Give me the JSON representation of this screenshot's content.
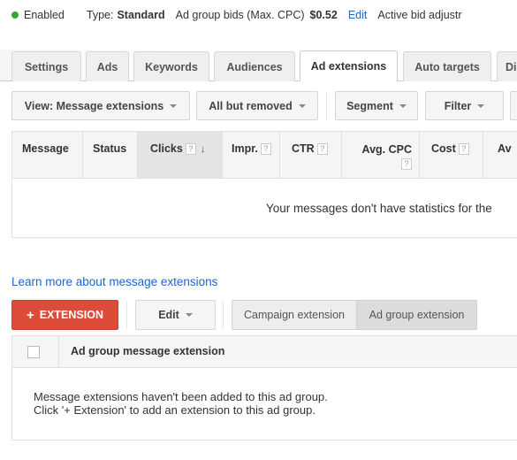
{
  "status_bar": {
    "status": "Enabled",
    "status_color": "#35a739",
    "type_label": "Type:",
    "type_value": "Standard",
    "bid_label": "Ad group bids (Max. CPC)",
    "bid_value": "$0.52",
    "edit_label": "Edit",
    "bid_adjust_label": "Active bid adjustr"
  },
  "tabs": [
    {
      "label": "Settings",
      "active": false
    },
    {
      "label": "Ads",
      "active": false
    },
    {
      "label": "Keywords",
      "active": false
    },
    {
      "label": "Audiences",
      "active": false
    },
    {
      "label": "Ad extensions",
      "active": true
    },
    {
      "label": "Auto targets",
      "active": false
    },
    {
      "label": "Di",
      "active": false
    }
  ],
  "toolbar": {
    "view": "View: Message extensions",
    "filter_status": "All but removed",
    "segment": "Segment",
    "filter": "Filter"
  },
  "stats_table": {
    "columns": [
      {
        "label": "Message",
        "help": false
      },
      {
        "label": "Status",
        "help": false
      },
      {
        "label": "Clicks",
        "help": true,
        "sorted": true,
        "sort_dir": "desc"
      },
      {
        "label": "Impr.",
        "help": true
      },
      {
        "label": "CTR",
        "help": true
      },
      {
        "label": "Avg. CPC",
        "help": true
      },
      {
        "label": "Cost",
        "help": true
      },
      {
        "label": "Av",
        "help": false
      }
    ],
    "help_glyph": "?",
    "sort_glyph": "↓",
    "empty_message": "Your messages don't have statistics for the"
  },
  "learn_more": "Learn more about message extensions",
  "extension_toolbar": {
    "add_label": "EXTENSION",
    "add_icon": "+",
    "add_color": "#dd4b39",
    "edit_label": "Edit",
    "segments": [
      "Campaign extension",
      "Ad group extension"
    ],
    "selected_segment": "Ad group extension"
  },
  "extension_table": {
    "column": "Ad group message extension",
    "empty_line1": "Message extensions haven't been added to this ad group.",
    "empty_line2": "Click '+ Extension' to add an extension to this ad group."
  }
}
